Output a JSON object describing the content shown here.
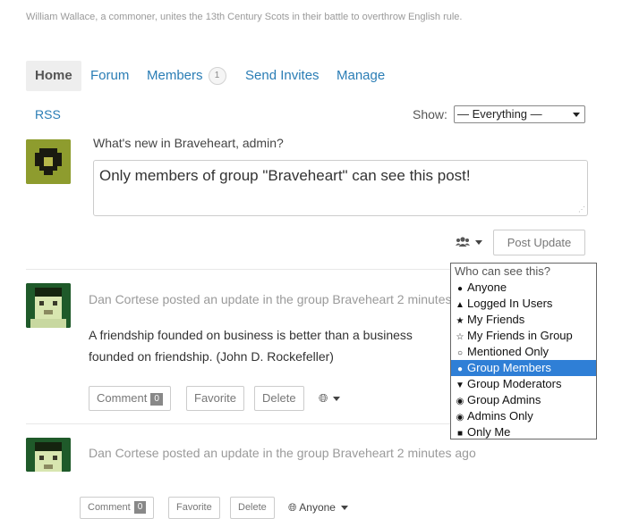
{
  "group": {
    "description": "William Wallace, a commoner, unites the 13th Century Scots in their battle to overthrow English rule."
  },
  "tabs": [
    {
      "label": "Home"
    },
    {
      "label": "Forum"
    },
    {
      "label": "Members",
      "count": "1"
    },
    {
      "label": "Send Invites"
    },
    {
      "label": "Manage"
    }
  ],
  "filter": {
    "rss_label": "RSS",
    "show_label": "Show:",
    "selected": "— Everything —"
  },
  "post_form": {
    "prompt": "What's new in Braveheart, admin?",
    "text": "Only members of group \"Braveheart\" can see this post!",
    "submit_label": "Post Update",
    "visibility_icon": "group-icon"
  },
  "visibility_menu": {
    "header": "Who can see this?",
    "options": [
      {
        "label": "Anyone",
        "icon": "globe-icon"
      },
      {
        "label": "Logged In Users",
        "icon": "user-icon"
      },
      {
        "label": "My Friends",
        "icon": "star-icon"
      },
      {
        "label": "My Friends in Group",
        "icon": "star-half-icon"
      },
      {
        "label": "Mentioned Only",
        "icon": "comment-icon"
      },
      {
        "label": "Group Members",
        "icon": "group-icon",
        "selected": true
      },
      {
        "label": "Group Moderators",
        "icon": "shield-icon"
      },
      {
        "label": "Group Admins",
        "icon": "eye-slash-icon"
      },
      {
        "label": "Admins Only",
        "icon": "eye-icon"
      },
      {
        "label": "Only Me",
        "icon": "lock-icon"
      }
    ]
  },
  "activities": [
    {
      "header": "Dan Cortese posted an update in the group Braveheart 2 minutes ago",
      "body": "A friendship founded on business is better than a business founded on friendship. (John D. Rockefeller)",
      "comment_label": "Comment",
      "comment_count": "0",
      "favorite_label": "Favorite",
      "delete_label": "Delete",
      "visibility_label": ""
    },
    {
      "header": "Dan Cortese posted an update in the group Braveheart 2 minutes ago",
      "comment_label": "Comment",
      "comment_count": "0",
      "favorite_label": "Favorite",
      "delete_label": "Delete",
      "visibility_label": "Anyone"
    }
  ]
}
